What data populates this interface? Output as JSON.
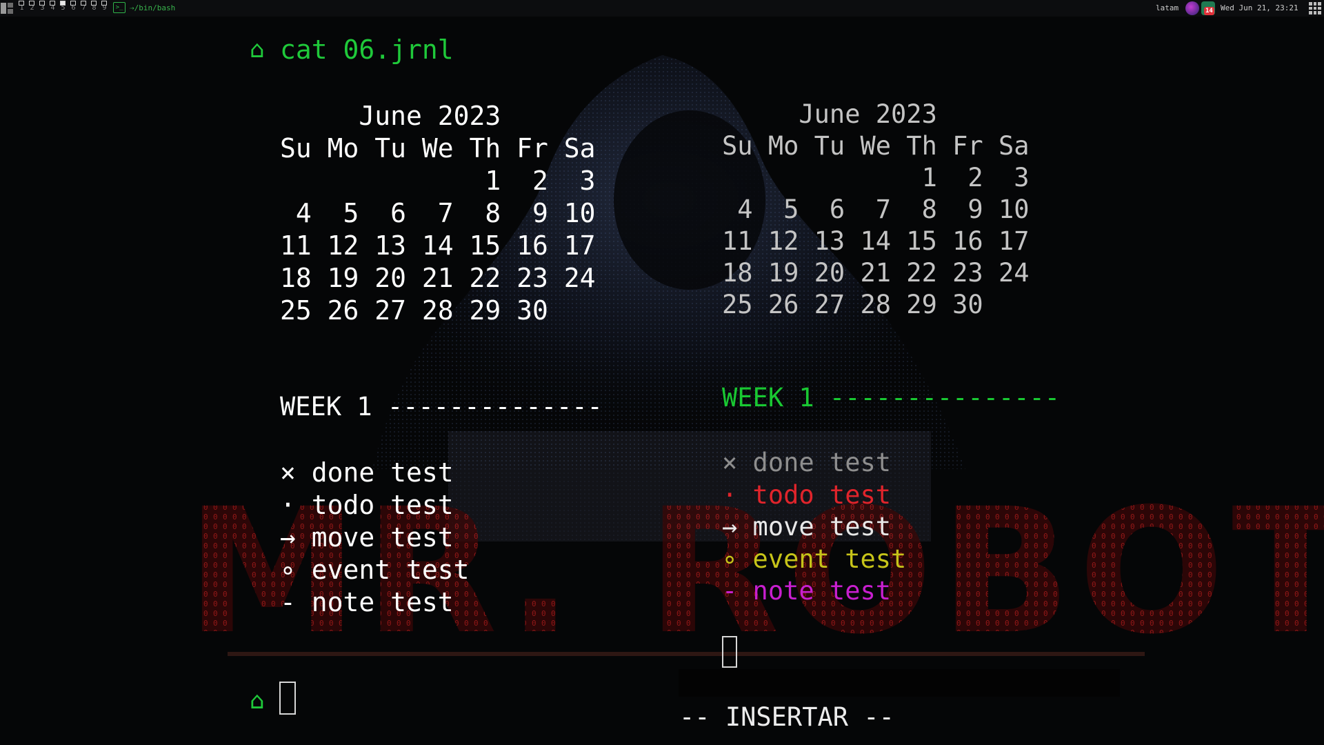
{
  "topbar": {
    "workspaces": [
      "1",
      "2",
      "3",
      "4",
      "5",
      "6",
      "7",
      "8",
      "9"
    ],
    "active_workspace": "5",
    "window_title": "⇢/bin/bash",
    "terminal_icon": "terminal-icon",
    "keyboard_layout": "latam",
    "notification_count": "14",
    "clock": "Wed Jun 21, 23:21"
  },
  "terminal": {
    "prompt_symbol": "⌂",
    "command": "cat 06.jrnl",
    "mode": "-- INSERTAR --"
  },
  "calendar": {
    "title": "June 2023",
    "weekdays": [
      "Su",
      "Mo",
      "Tu",
      "We",
      "Th",
      "Fr",
      "Sa"
    ],
    "weeks": [
      [
        "",
        "",
        "",
        "",
        "1",
        "2",
        "3"
      ],
      [
        "4",
        "5",
        "6",
        "7",
        "8",
        "9",
        "10"
      ],
      [
        "11",
        "12",
        "13",
        "14",
        "15",
        "16",
        "17"
      ],
      [
        "18",
        "19",
        "20",
        "21",
        "22",
        "23",
        "24"
      ],
      [
        "25",
        "26",
        "27",
        "28",
        "29",
        "30",
        ""
      ]
    ]
  },
  "journal": {
    "week_header_left": "WEEK 1 --------------",
    "week_header_right": "WEEK 1 ---------------",
    "entries": [
      {
        "symbol": "×",
        "text": "done test",
        "kind": "done"
      },
      {
        "symbol": "·",
        "text": "todo test",
        "kind": "todo"
      },
      {
        "symbol": "→",
        "text": "move test",
        "kind": "move"
      },
      {
        "symbol": "∘",
        "text": "event test",
        "kind": "event"
      },
      {
        "symbol": "-",
        "text": "note test",
        "kind": "note"
      }
    ]
  },
  "wallpaper": {
    "text": "MR. ROBOT",
    "text_color": "#b01a1a"
  }
}
